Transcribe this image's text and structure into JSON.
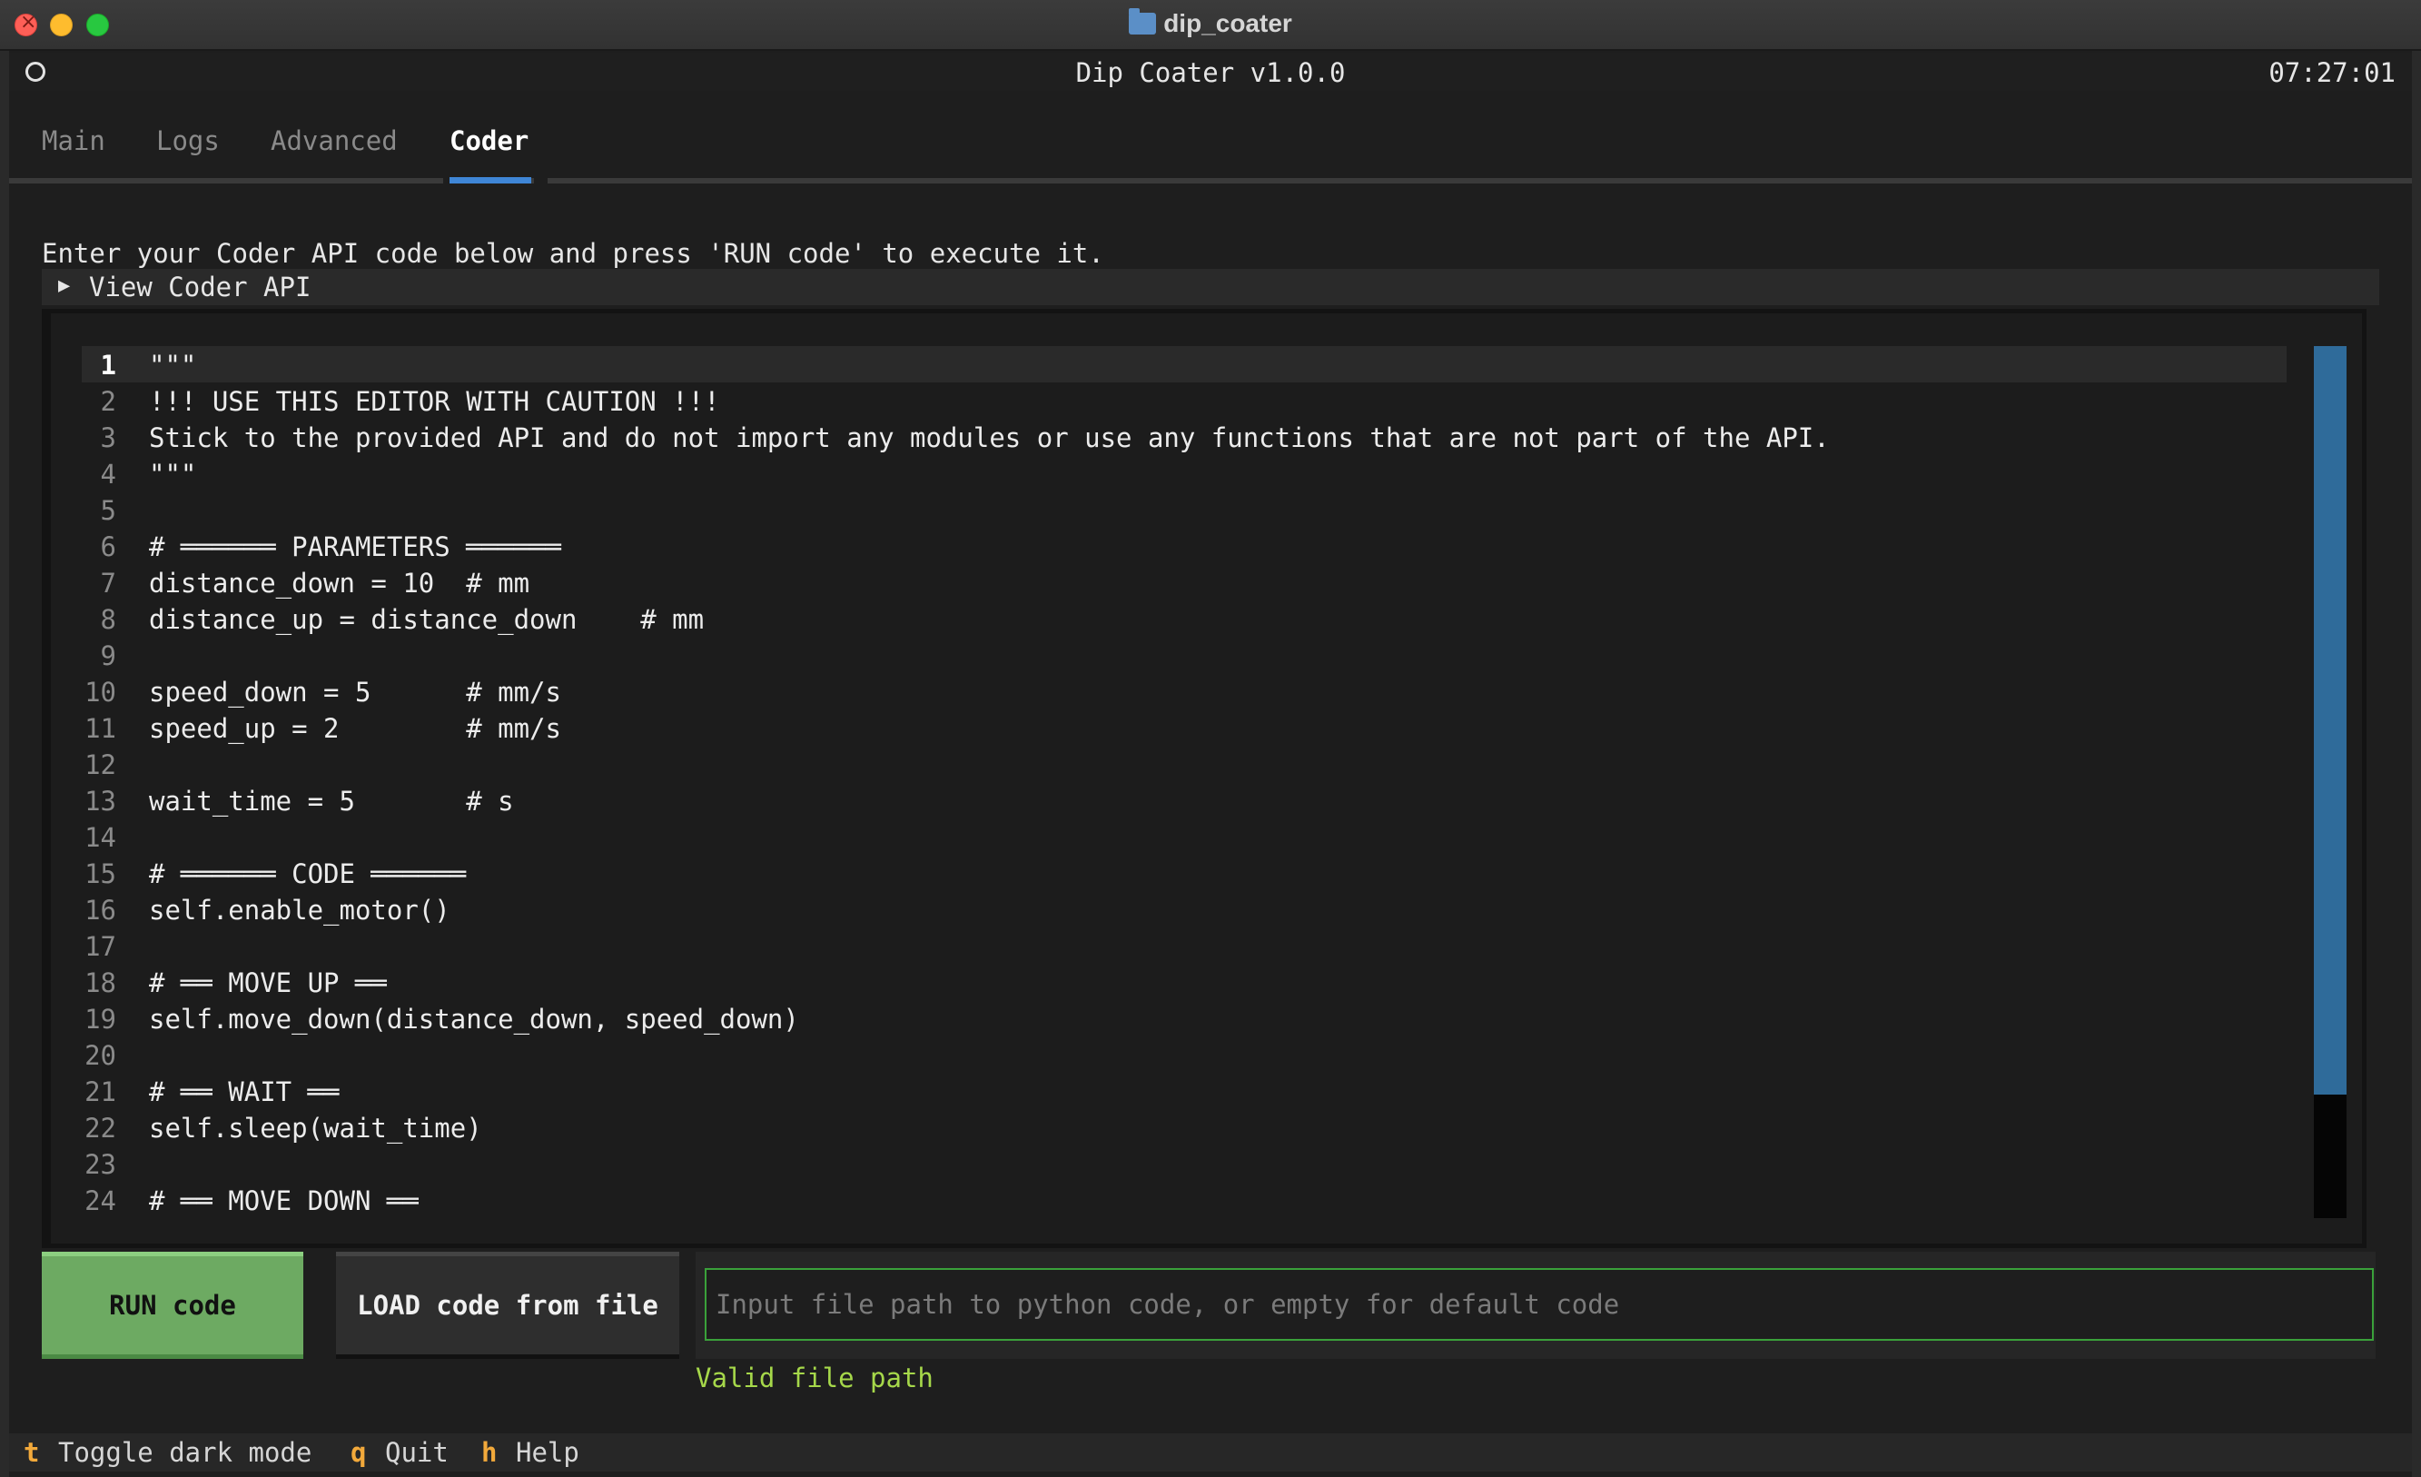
{
  "window": {
    "title": "dip_coater"
  },
  "header": {
    "app_title": "Dip Coater v1.0.0",
    "clock": "07:27:01"
  },
  "tabs": [
    {
      "label": "Main",
      "active": false
    },
    {
      "label": "Logs",
      "active": false
    },
    {
      "label": "Advanced",
      "active": false
    },
    {
      "label": "Coder",
      "active": true
    }
  ],
  "coder": {
    "intro": "Enter your Coder API code below and press 'RUN code' to execute it.",
    "collapsible_label": "View Coder API",
    "lines": [
      "\"\"\"",
      "!!! USE THIS EDITOR WITH CAUTION !!!",
      "Stick to the provided API and do not import any modules or use any functions that are not part of the API.",
      "\"\"\"",
      "",
      "# ══════ PARAMETERS ══════",
      "distance_down = 10  # mm",
      "distance_up = distance_down    # mm",
      "",
      "speed_down = 5      # mm/s",
      "speed_up = 2        # mm/s",
      "",
      "wait_time = 5       # s",
      "",
      "# ══════ CODE ══════",
      "self.enable_motor()",
      "",
      "# ══ MOVE UP ══",
      "self.move_down(distance_down, speed_down)",
      "",
      "# ══ WAIT ══",
      "self.sleep(wait_time)",
      "",
      "# ══ MOVE DOWN ══"
    ],
    "line_numbers": [
      "1",
      "2",
      "3",
      "4",
      "5",
      "6",
      "7",
      "8",
      "9",
      "10",
      "11",
      "12",
      "13",
      "14",
      "15",
      "16",
      "17",
      "18",
      "19",
      "20",
      "21",
      "22",
      "23",
      "24"
    ],
    "current_line": 1,
    "run_label": "RUN code",
    "load_label": "LOAD code from file",
    "path_placeholder": "Input file path to python code, or empty for default code",
    "path_value": "",
    "path_status": "Valid file path"
  },
  "footer": [
    {
      "key": "t",
      "label": "Toggle dark mode"
    },
    {
      "key": "q",
      "label": "Quit"
    },
    {
      "key": "h",
      "label": "Help"
    }
  ],
  "colors": {
    "accent": "#3f86d6",
    "run_button": "#6daa62",
    "valid": "#a6d84a",
    "key": "#f2a93b",
    "scroll_thumb": "#2f6b9a"
  }
}
